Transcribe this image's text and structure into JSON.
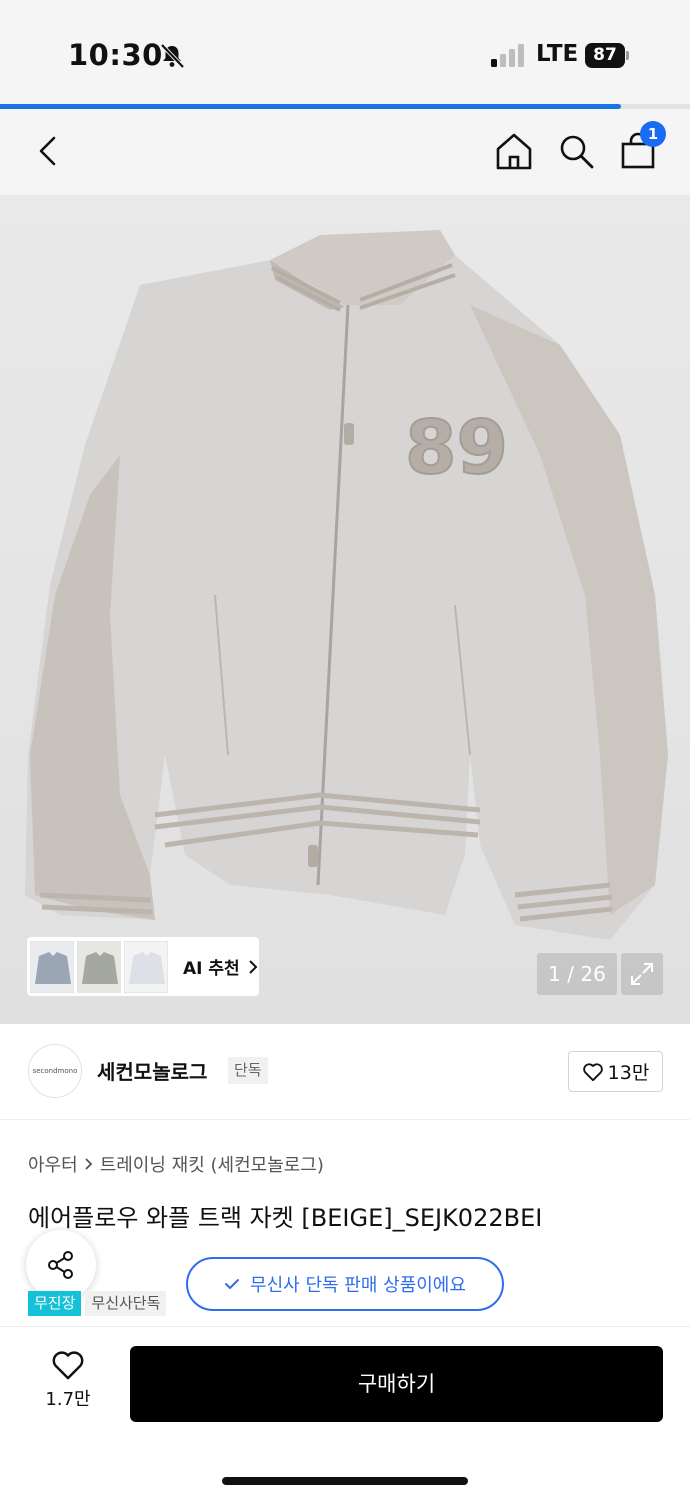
{
  "status_bar": {
    "time": "10:30",
    "network": "LTE",
    "battery": "87"
  },
  "page_load": {
    "progress": 0.9
  },
  "header": {
    "cart_count": "1"
  },
  "gallery": {
    "counter": "1 / 26",
    "ai_label": "AI 추천"
  },
  "brand": {
    "logo_text": "secondmono",
    "name": "세컨모놀로그",
    "tag": "단독",
    "likes": "13만"
  },
  "breadcrumb": [
    "아우터",
    "트레이닝 재킷 (세컨모놀로그)"
  ],
  "product": {
    "title": "에어플로우 와플 트랙 자켓 [BEIGE]_SEJK022BEI"
  },
  "notice": "무신사 단독 판매 상품이에요",
  "tags": {
    "free_shipping": "무진장",
    "exclusive": "무신사단독"
  },
  "bottom_bar": {
    "wish_count": "1.7만",
    "buy_label": "구매하기"
  },
  "colors": {
    "accent": "#2f6df0",
    "badge": "#1a6bf3",
    "tag_free": "#14c1d6",
    "buy": "#000000"
  }
}
